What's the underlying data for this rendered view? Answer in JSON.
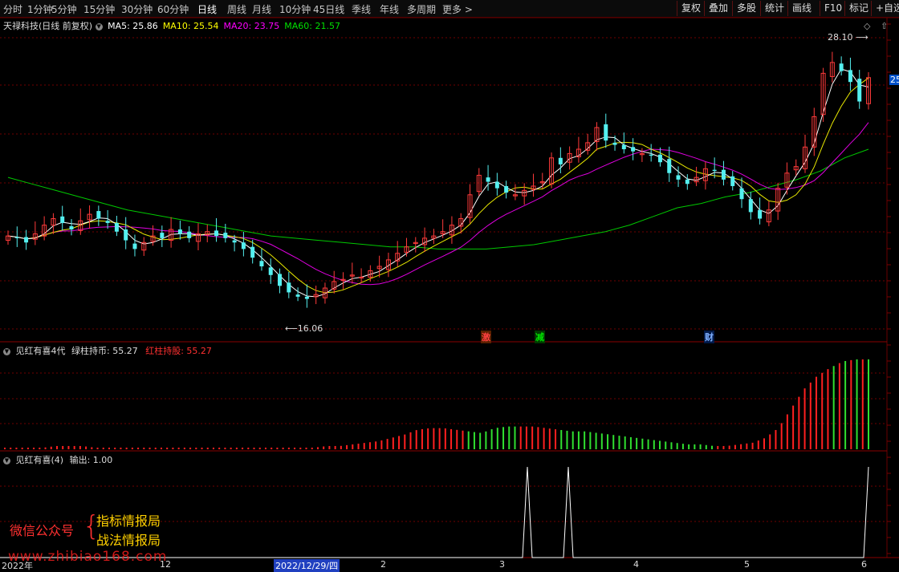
{
  "toolbar": {
    "tabs": [
      "分时",
      "1分钟",
      "5分钟",
      "15分钟",
      "30分钟",
      "60分钟",
      "日线",
      "周线",
      "月线",
      "10分钟",
      "45日线",
      "季线",
      "年线",
      "多周期",
      "更多 >"
    ],
    "active_tab": "日线",
    "right_buttons": [
      "复权",
      "叠加",
      "多股",
      "统计",
      "画线",
      "F10",
      "标记",
      "+自选"
    ]
  },
  "main_panel": {
    "title": "天禄科技(日线 前复权)",
    "ma_labels": [
      {
        "text": "MA5: 25.86",
        "color": "#ffffff"
      },
      {
        "text": "MA10: 25.54",
        "color": "#ffff00"
      },
      {
        "text": "MA20: 23.75",
        "color": "#ff00ff"
      },
      {
        "text": "MA60: 21.57",
        "color": "#00e000"
      }
    ],
    "high_label": "28.10",
    "low_label": "16.06",
    "price_tag": "25",
    "markers": [
      {
        "text": "激",
        "color": "#ff4040"
      },
      {
        "text": "减",
        "color": "#00e000"
      },
      {
        "text": "财",
        "color": "#7fb0ff"
      }
    ]
  },
  "indicator1": {
    "name": "见红有喜4代",
    "green_label": "绿柱持币: 55.27",
    "red_label": "红柱持股: 55.27"
  },
  "indicator2": {
    "name": "见红有喜(4)",
    "output_label": "输出: 1.00"
  },
  "watermark": {
    "wechat": "微信公众号",
    "line1": "指标情报局",
    "line2": "战法情报局",
    "url": "www.zhibiao168.com"
  },
  "axis": {
    "labels": [
      "2022年",
      "12",
      "2022/12/29/四",
      "2",
      "3",
      "4",
      "5",
      "6"
    ]
  },
  "chart_data": {
    "type": "candlestick",
    "price_range": [
      15.5,
      29.0
    ],
    "closes": [
      19.6,
      19.5,
      19.3,
      19.7,
      20.1,
      20.4,
      20.2,
      19.9,
      20.3,
      20.6,
      20.4,
      20.2,
      19.8,
      19.4,
      19.0,
      19.3,
      19.6,
      19.5,
      19.9,
      19.7,
      19.5,
      19.7,
      19.8,
      19.6,
      19.5,
      19.3,
      19.0,
      18.6,
      18.2,
      17.8,
      17.3,
      17.0,
      16.8,
      16.7,
      16.9,
      17.2,
      17.5,
      17.6,
      17.8,
      17.7,
      18.0,
      18.2,
      18.5,
      18.8,
      19.1,
      19.3,
      19.5,
      19.6,
      19.8,
      20.1,
      20.4,
      21.5,
      22.4,
      22.1,
      21.8,
      21.6,
      21.5,
      21.7,
      21.9,
      22.1,
      23.2,
      22.9,
      23.4,
      23.6,
      23.9,
      24.6,
      24.0,
      23.8,
      23.6,
      23.5,
      23.4,
      23.3,
      23.0,
      22.5,
      22.2,
      22.0,
      22.3,
      22.7,
      22.6,
      22.2,
      21.9,
      21.3,
      20.7,
      20.4,
      20.8,
      21.8,
      22.5,
      22.8,
      23.7,
      25.1,
      27.1,
      27.6,
      27.2,
      26.7,
      25.8,
      26.9
    ],
    "ma60": [
      22.3,
      22.0,
      21.7,
      21.4,
      21.1,
      20.8,
      20.6,
      20.4,
      20.2,
      20.0,
      19.8,
      19.6,
      19.5,
      19.4,
      19.3,
      19.2,
      19.1,
      19.1,
      19.0,
      19.0,
      19.0,
      19.1,
      19.2,
      19.4,
      19.6,
      19.8,
      20.1,
      20.5,
      20.9,
      21.1,
      21.4,
      21.6,
      21.9,
      22.2,
      22.6,
      23.2,
      23.6
    ],
    "red_bars": [
      1,
      1,
      1,
      1,
      2,
      2,
      2,
      1,
      1,
      1,
      1,
      1,
      1,
      1,
      1,
      1,
      1,
      1,
      1,
      1,
      1,
      1,
      1,
      1,
      1,
      2,
      2,
      3,
      4,
      5,
      7,
      9,
      12,
      13,
      13,
      12,
      11,
      10,
      13,
      14,
      14,
      14,
      13,
      12,
      11,
      11,
      10,
      9,
      8,
      7,
      6,
      5,
      4,
      3,
      3,
      2,
      2,
      3,
      4,
      7,
      13,
      25,
      37,
      45,
      50,
      54,
      55.27,
      55.27
    ],
    "output_signal_x": [
      657,
      708,
      1082
    ]
  }
}
